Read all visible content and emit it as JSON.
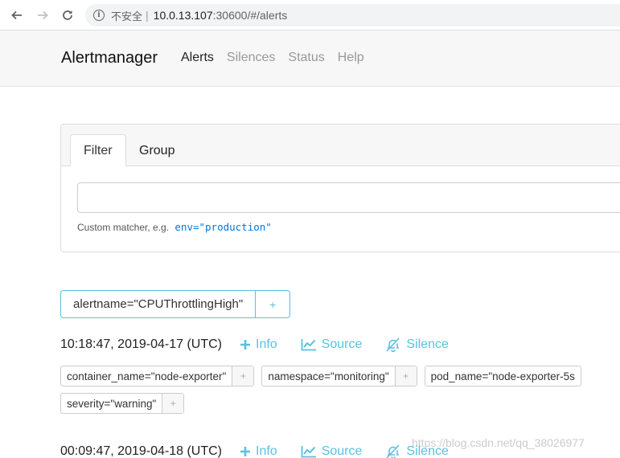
{
  "browser": {
    "insecure_label": "不安全",
    "url_host": "10.0.13.107",
    "url_rest": ":30600/#/alerts"
  },
  "app": {
    "brand": "Alertmanager",
    "nav": [
      "Alerts",
      "Silences",
      "Status",
      "Help"
    ]
  },
  "filter": {
    "tabs": [
      "Filter",
      "Group"
    ],
    "input_value": "",
    "hint_text": "Custom matcher, e.g.",
    "hint_example": "env=\"production\""
  },
  "group": {
    "label": "alertname=\"CPUThrottlingHigh\"",
    "plus": "+"
  },
  "alerts": [
    {
      "timestamp": "10:18:47, 2019-04-17 (UTC)",
      "info": "Info",
      "source": "Source",
      "silence": "Silence",
      "labels_row1": [
        "container_name=\"node-exporter\"",
        "namespace=\"monitoring\"",
        "pod_name=\"node-exporter-5s"
      ],
      "labels_row2": [
        "severity=\"warning\""
      ]
    },
    {
      "timestamp": "00:09:47, 2019-04-18 (UTC)",
      "info": "Info",
      "source": "Source",
      "silence": "Silence"
    }
  ],
  "watermark": "https://blog.csdn.net/qq_38026977",
  "colors": {
    "accent": "#5bc0de",
    "link": "#0275d8"
  }
}
